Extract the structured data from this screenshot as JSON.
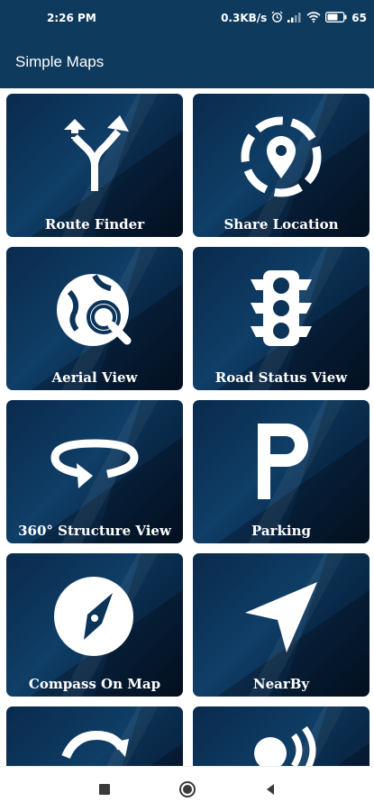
{
  "status": {
    "time": "2:26 PM",
    "speed": "0.3KB/s",
    "battery": "65",
    "icons": [
      "alarm-icon",
      "signal-icon",
      "wifi-icon",
      "battery-icon"
    ]
  },
  "app": {
    "title": "Simple Maps"
  },
  "tiles": [
    {
      "label": "Route Finder",
      "icon": "route-split-icon"
    },
    {
      "label": "Share Location",
      "icon": "location-share-icon"
    },
    {
      "label": "Aerial View",
      "icon": "globe-search-icon"
    },
    {
      "label": "Road Status View",
      "icon": "traffic-light-icon"
    },
    {
      "label": "360° Structure View",
      "icon": "rotate-360-icon"
    },
    {
      "label": "Parking",
      "icon": "parking-icon"
    },
    {
      "label": "Compass On Map",
      "icon": "compass-icon"
    },
    {
      "label": "NearBy",
      "icon": "navigation-arrow-icon"
    },
    {
      "label": "",
      "icon": "sync-icon"
    },
    {
      "label": "",
      "icon": "voice-person-icon"
    }
  ],
  "navbar": {
    "icons": [
      "recents-icon",
      "home-icon",
      "back-icon"
    ]
  },
  "colors": {
    "bar": "#0e3a5e",
    "tile_dark": "#0a2a4d",
    "tile_light": "#0f3e66"
  }
}
